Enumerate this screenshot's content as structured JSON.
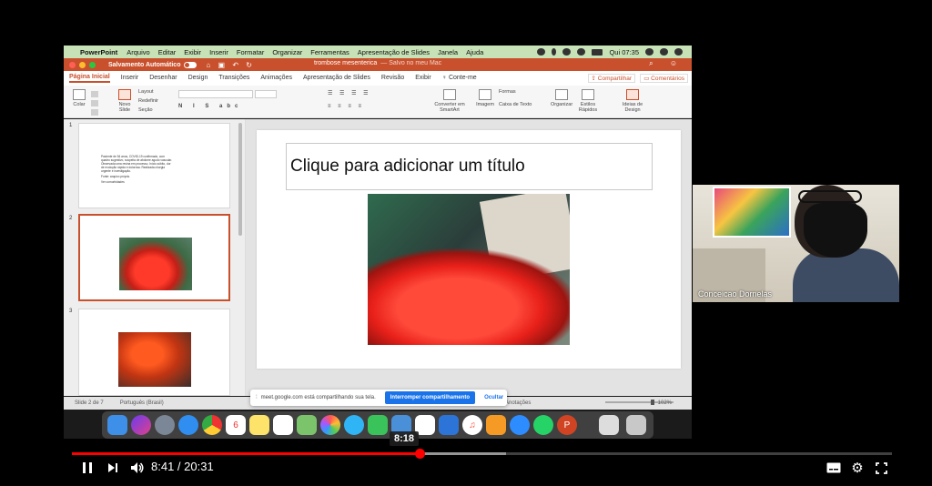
{
  "mac_menubar": {
    "app": "PowerPoint",
    "menus": [
      "Arquivo",
      "Editar",
      "Exibir",
      "Inserir",
      "Formatar",
      "Organizar",
      "Ferramentas",
      "Apresentação de Slides",
      "Janela",
      "Ajuda"
    ],
    "clock": "Qui 07:35"
  },
  "titlebar": {
    "autosave": "Salvamento Automático",
    "document": "trombose mesenterica",
    "saved_status": "— Salvo no meu Mac"
  },
  "ribbon_tabs": [
    "Página Inicial",
    "Inserir",
    "Desenhar",
    "Design",
    "Transições",
    "Animações",
    "Apresentação de Slides",
    "Revisão",
    "Exibir",
    "Conte-me"
  ],
  "ribbon_actions": {
    "share": "Compartilhar",
    "comments": "Comentários"
  },
  "ribbon": {
    "paste": "Colar",
    "new_slide": "Novo Slide",
    "layout": "Layout",
    "reset": "Redefinir",
    "section": "Seção",
    "smartart": "Converter em SmartArt",
    "image": "Imagem",
    "shapes": "Formas",
    "textbox": "Caixa de Texto",
    "arrange": "Organizar",
    "quick_styles": "Estilos Rápidos",
    "design_ideas": "Ideias de Design"
  },
  "thumbnails": [
    {
      "number": "1",
      "lines": [
        "Paciente de 54 anos, COVID-19 confirmado, com quadro sugestivo, suspeita de abdome agudo vascular. Observada uma resina em processo. Início súbito, dor de evolução rápida e dolorosa. Realizada cirurgia urgente e investigação.",
        "Fonte: arquivo próprio.",
        "Ver comorbidades"
      ]
    },
    {
      "number": "2"
    },
    {
      "number": "3"
    }
  ],
  "slide": {
    "title_placeholder": "Clique para adicionar um título"
  },
  "statusbar": {
    "slide_counter": "Slide 2 de 7",
    "language": "Português (Brasil)",
    "notes": "Anotações",
    "zoom": "102%"
  },
  "share_notice": {
    "message": "meet.google.com está compartilhando sua tela.",
    "stop_button": "Interromper compartilhamento",
    "hide_button": "Ocultar"
  },
  "dock_icons": [
    "finder-icon",
    "siri-icon",
    "launchpad-icon",
    "safari-icon",
    "chrome-icon",
    "calendar-icon",
    "notes-icon",
    "reminders-icon",
    "maps-icon",
    "photos-icon",
    "messages-icon",
    "facetime-icon",
    "keynote-icon",
    "numbers-icon",
    "keynote-podium-icon",
    "music-icon",
    "books-icon",
    "zoom-icon",
    "whatsapp-icon",
    "powerpoint-icon",
    "preview-icon",
    "trash-icon"
  ],
  "webcam": {
    "participant": "Conceicao Dornelas"
  },
  "player": {
    "hover_time": "8:18",
    "current_time": "8:41",
    "duration": "20:31",
    "time_display": "8:41 / 20:31",
    "played_fraction": 0.424,
    "buffered_fraction": 0.529
  },
  "colors": {
    "accent": "#c9502c",
    "progress": "#ff0000",
    "mac_menubar": "#c7e2b6"
  }
}
